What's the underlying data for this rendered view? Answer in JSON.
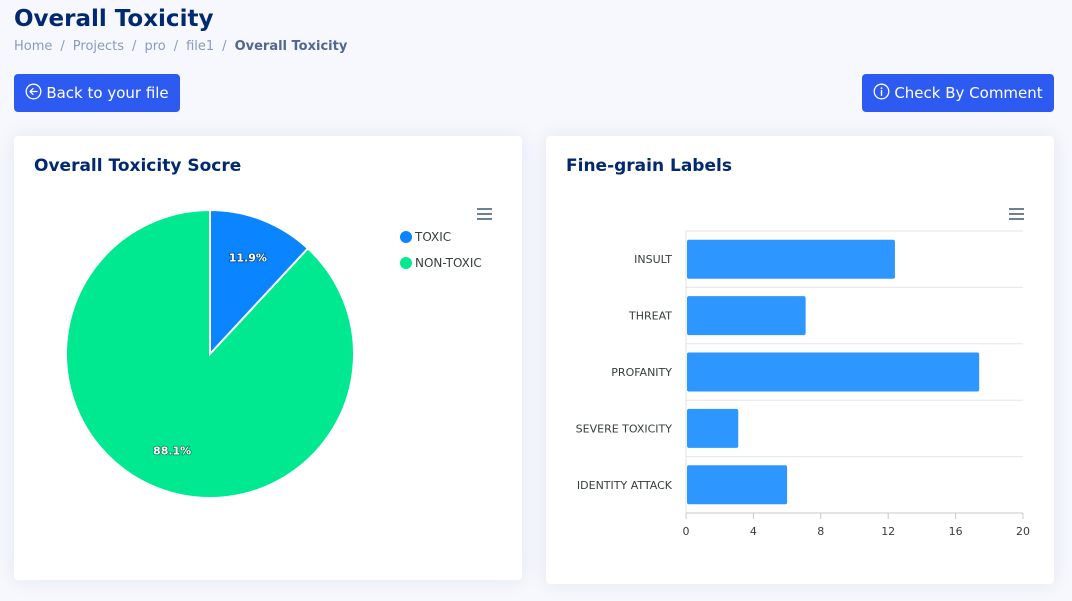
{
  "page": {
    "title": "Overall Toxicity",
    "breadcrumb": [
      "Home",
      "Projects",
      "pro",
      "file1",
      "Overall Toxicity"
    ]
  },
  "buttons": {
    "back_label": "Back to your file",
    "back_icon": "arrow-left-circle-icon",
    "check_label": "Check By Comment",
    "check_icon": "info-circle-icon",
    "color": "#2d5af0"
  },
  "pie_card": {
    "title": "Overall Toxicity Socre"
  },
  "bar_card": {
    "title": "Fine-grain Labels"
  },
  "chart_data": [
    {
      "type": "pie",
      "title": "Overall Toxicity Socre",
      "slices": [
        {
          "label": "TOXIC",
          "value": 11.9,
          "display": "11.9%",
          "color": "#0a84ff"
        },
        {
          "label": "NON-TOXIC",
          "value": 88.1,
          "display": "88.1%",
          "color": "#00e991"
        }
      ],
      "legend": "top-right"
    },
    {
      "type": "bar",
      "orientation": "horizontal",
      "title": "Fine-grain Labels",
      "categories": [
        "INSULT",
        "THREAT",
        "PROFANITY",
        "SEVERE TOXICITY",
        "IDENTITY ATTACK"
      ],
      "values": [
        12.4,
        7.1,
        17.4,
        3.1,
        6.0
      ],
      "xlim": [
        0,
        20
      ],
      "xticks": [
        0,
        4,
        8,
        12,
        16,
        20
      ],
      "color": "#2e96ff",
      "grid": true
    }
  ]
}
